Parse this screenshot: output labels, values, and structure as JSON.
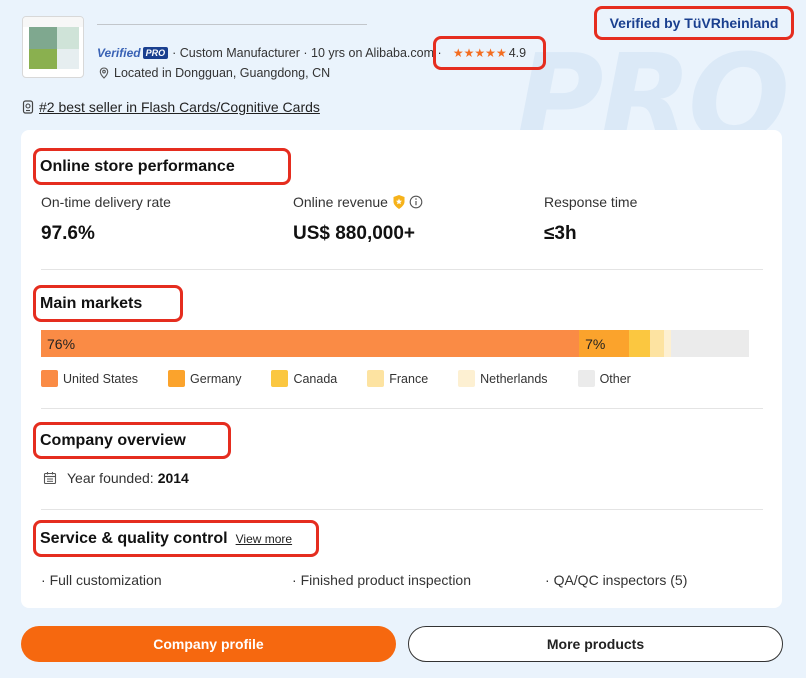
{
  "header": {
    "verified_by": "Verified by TüVRheinland",
    "verified_word": "Verified",
    "pro_label": "PRO",
    "meta_text": " · Custom Manufacturer · 10 yrs on Alibaba.com ·",
    "rating_stars": "★★★★★",
    "rating_value": "4.9",
    "location": "Located in Dongguan, Guangdong, CN",
    "bestseller": "#2 best seller in Flash Cards/Cognitive Cards",
    "background_watermark": "PRO"
  },
  "performance": {
    "title": "Online store performance",
    "metrics": [
      {
        "label": "On-time delivery rate",
        "value": "97.6%"
      },
      {
        "label": "Online revenue",
        "value": "US$ 880,000+"
      },
      {
        "label": "Response time",
        "value": "≤3h"
      }
    ]
  },
  "markets": {
    "title": "Main markets",
    "segments": [
      {
        "name": "United States",
        "percent": 76,
        "label": "76%",
        "color": "#fa8b45"
      },
      {
        "name": "Germany",
        "percent": 7,
        "label": "7%",
        "color": "#fba32c"
      },
      {
        "name": "Canada",
        "percent": 3,
        "label": "",
        "color": "#fbc740"
      },
      {
        "name": "France",
        "percent": 2,
        "label": "",
        "color": "#fde3a1"
      },
      {
        "name": "Netherlands",
        "percent": 1,
        "label": "",
        "color": "#fdf0d2"
      },
      {
        "name": "Other",
        "percent": 11,
        "label": "",
        "color": "#ebebeb"
      }
    ]
  },
  "overview": {
    "title": "Company overview",
    "founded_label": "Year founded:",
    "founded_value": "2014"
  },
  "service": {
    "title": "Service & quality control",
    "view_more": "View more",
    "items": [
      "Full customization",
      "Finished product inspection",
      "QA/QC inspectors (5)"
    ]
  },
  "actions": {
    "primary": "Company profile",
    "secondary": "More products"
  }
}
